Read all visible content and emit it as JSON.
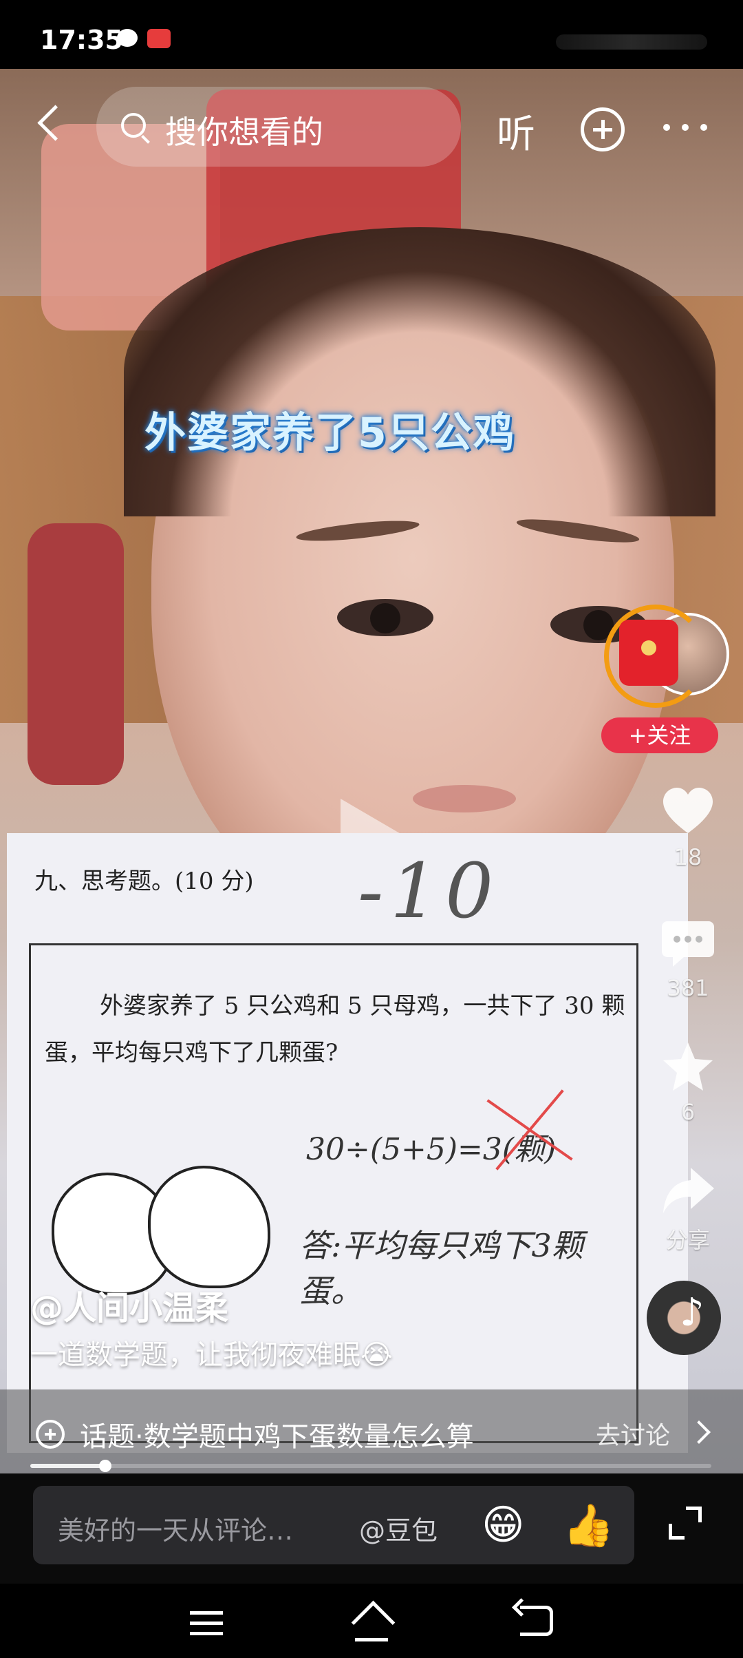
{
  "status_bar": {
    "time": "17:35",
    "app_icons": [
      "wechat-icon",
      "toutiao-icon"
    ]
  },
  "top_bar": {
    "search_placeholder": "搜你想看的",
    "listen_label": "听",
    "icons": [
      "back-icon",
      "search-icon",
      "plus-icon",
      "more-icon"
    ]
  },
  "video": {
    "overlay_title": "外婆家养了5只公鸡",
    "paper": {
      "heading": "九、思考题。(10 分)",
      "score_mark": "-10",
      "question_line1": "外婆家养了 5 只公鸡和 5 只母鸡，一共下了 30 颗",
      "question_line2": "蛋，平均每只鸡下了几颗蛋?",
      "work": "30÷(5+5)=3(颗)",
      "answer": "答:平均每只鸡下3颗蛋。"
    }
  },
  "side_rail": {
    "follow_label": "+关注",
    "like_count": "18",
    "comment_count": "381",
    "favorite_count": "6",
    "share_label": "分享"
  },
  "post": {
    "author": "@人间小温柔",
    "caption": "一道数学题，让我彻夜难眠😭"
  },
  "topic": {
    "text": "话题·数学题中鸡下蛋数量怎么算",
    "action": "去讨论"
  },
  "progress": {
    "played_fraction": 0.11
  },
  "comment_bar": {
    "placeholder": "美好的一天从评论…",
    "mention": "@豆包",
    "emoji_1": "😁",
    "emoji_2": "👍"
  },
  "colors": {
    "accent_red": "#e8334a",
    "overlay_blue": "#2a7fd0"
  }
}
